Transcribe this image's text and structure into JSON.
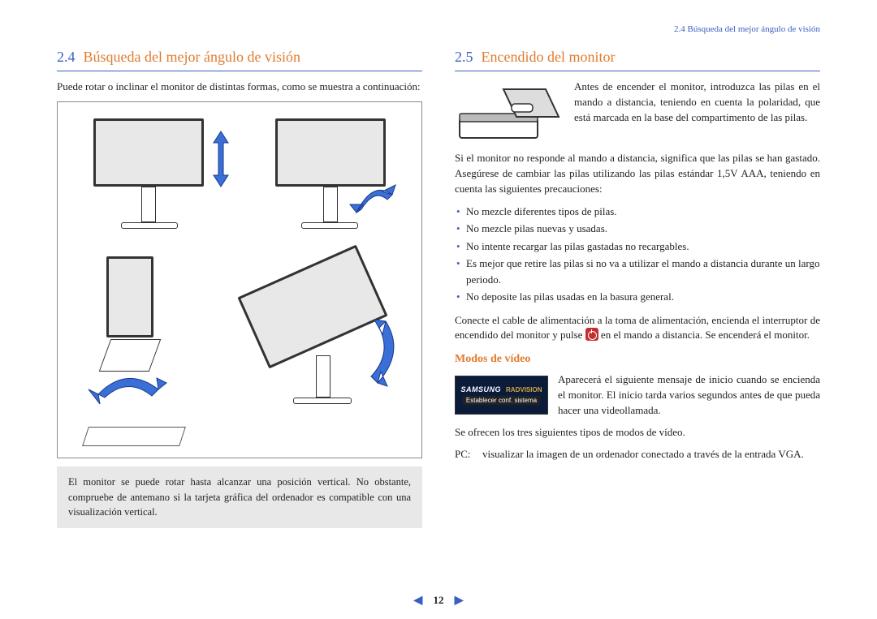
{
  "runningHead": "2.4 Búsqueda del mejor ángulo de visión",
  "left": {
    "sec_num": "2.4",
    "sec_title": "Búsqueda del mejor ángulo de visión",
    "intro": "Puede rotar o inclinar el monitor de distintas formas, como se muestra a continuación:",
    "note": "El monitor se puede rotar hasta alcanzar una posición vertical. No obstante, compruebe de antemano si la tarjeta gráfica del ordenador es compatible con una visualización vertical."
  },
  "right": {
    "sec_num": "2.5",
    "sec_title": "Encendido del monitor",
    "p1": "Antes de encender el monitor, introduzca las pilas en el mando a distancia, teniendo en cuenta la polaridad, que está marcada en la base del compartimento de las pilas.",
    "p2": "Si el monitor no responde al mando a distancia, significa que las pilas se han gastado. Asegúrese de cambiar las pilas utilizando las pilas estándar 1,5V AAA, teniendo en cuenta las siguientes precauciones:",
    "bullets": [
      "No mezcle diferentes tipos de pilas.",
      "No mezcle pilas nuevas y usadas.",
      "No intente recargar las pilas gastadas no recargables.",
      "Es mejor que retire las pilas si no va a utilizar el mando a distancia durante un largo periodo.",
      "No deposite las pilas usadas en la basura general."
    ],
    "p3_a": "Conecte el cable de alimentación a la toma de alimentación, encienda el interruptor de encendido del monitor y pulse ",
    "p3_b": " en el mando a distancia. Se encenderá el monitor.",
    "sub_h": "Modos de vídeo",
    "badge_brand1": "SAMSUNG",
    "badge_brand2": "RADVISION",
    "badge_sub": "Establecer conf. sistema",
    "p4": "Aparecerá el siguiente mensaje de inicio cuando se encienda el monitor. El inicio tarda varios segundos antes de que pueda hacer una videollamada.",
    "p5": "Se ofrecen los tres siguientes tipos de modos de vídeo.",
    "def_term": "PC:",
    "def_body": "visualizar la imagen de un ordenador conectado a través de la entrada VGA."
  },
  "pager": {
    "page": "12"
  }
}
